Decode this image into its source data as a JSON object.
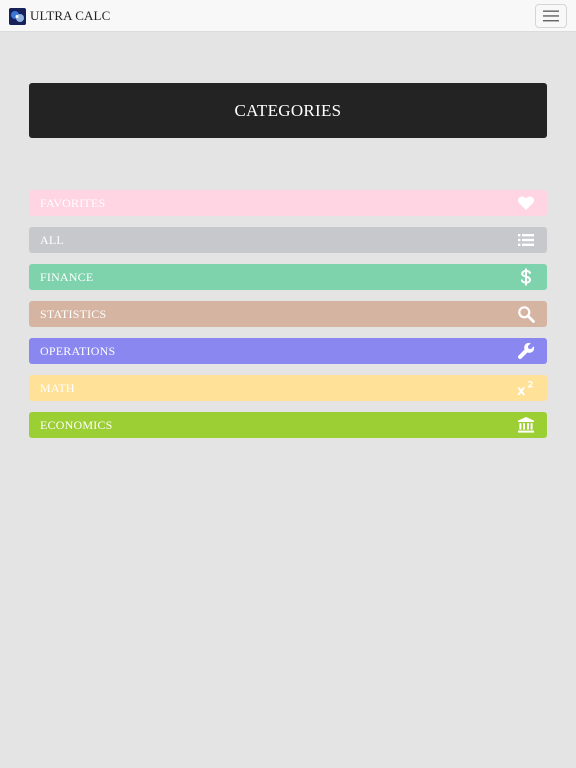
{
  "app": {
    "name": "ULTRA CALC"
  },
  "page": {
    "title": "CATEGORIES"
  },
  "categories": [
    {
      "label": "FAVORITES",
      "icon": "heart-icon",
      "color": "#ffd4e3"
    },
    {
      "label": "ALL",
      "icon": "list-icon",
      "color": "#c6c8cc"
    },
    {
      "label": "FINANCE",
      "icon": "dollar-icon",
      "color": "#7ed3ad"
    },
    {
      "label": "STATISTICS",
      "icon": "search-icon",
      "color": "#d6b4a2"
    },
    {
      "label": "OPERATIONS",
      "icon": "wrench-icon",
      "color": "#8a87f0"
    },
    {
      "label": "MATH",
      "icon": "superscript-icon",
      "color": "#ffe197"
    },
    {
      "label": "ECONOMICS",
      "icon": "bank-icon",
      "color": "#9ccf34"
    }
  ]
}
